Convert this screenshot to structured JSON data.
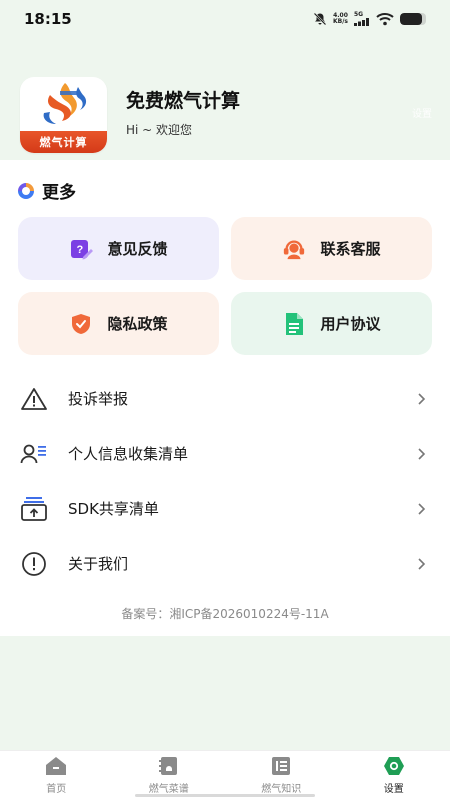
{
  "status_bar": {
    "time": "18:15",
    "net_speed_value": "4.00",
    "net_speed_unit": "KB/s",
    "network": "5G",
    "battery_level": 0.85
  },
  "header": {
    "logo_text": "燃气计算",
    "app_name": "免费燃气计算",
    "welcome": "Hi ~ 欢迎您",
    "ghost_label": "设置"
  },
  "section": {
    "title": "更多"
  },
  "tiles": [
    {
      "label": "意见反馈",
      "icon": "edit-icon",
      "bg": "#efeefc",
      "icon_color": "#7b3fe4"
    },
    {
      "label": "联系客服",
      "icon": "headset-icon",
      "bg": "#fdf1ea",
      "icon_color": "#f0693a"
    },
    {
      "label": "隐私政策",
      "icon": "shield-icon",
      "bg": "#fdf1ea",
      "icon_color": "#f0693a"
    },
    {
      "label": "用户协议",
      "icon": "document-icon",
      "bg": "#e9f6ee",
      "icon_color": "#23c27a"
    }
  ],
  "list": [
    {
      "label": "投诉举报",
      "icon": "warning-icon"
    },
    {
      "label": "个人信息收集清单",
      "icon": "user-list-icon"
    },
    {
      "label": "SDK共享清单",
      "icon": "share-box-icon"
    },
    {
      "label": "关于我们",
      "icon": "info-icon"
    }
  ],
  "record": "备案号：湘ICP备2026010224号-11A",
  "nav": [
    {
      "label": "首页",
      "icon": "home-icon",
      "active": false
    },
    {
      "label": "燃气菜谱",
      "icon": "recipe-icon",
      "active": false
    },
    {
      "label": "燃气知识",
      "icon": "book-icon",
      "active": false
    },
    {
      "label": "设置",
      "icon": "settings-icon",
      "active": true
    }
  ],
  "colors": {
    "background": "#eef6ee",
    "accent_green": "#1f9e55",
    "text": "#1c1c1c",
    "muted": "#8a8a8a"
  }
}
